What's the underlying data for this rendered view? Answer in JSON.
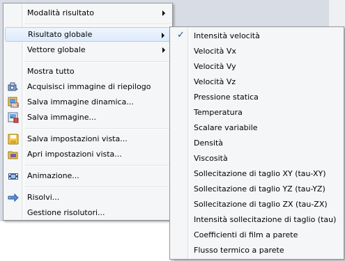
{
  "main_menu": {
    "items": [
      {
        "label": "Modalità risultato"
      },
      {
        "label": "Risultato globale"
      },
      {
        "label": "Vettore globale"
      },
      {
        "label": "Mostra tutto"
      },
      {
        "label": "Acquisisci immagine di riepilogo"
      },
      {
        "label": "Salva immagine dinamica..."
      },
      {
        "label": "Salva immagine..."
      },
      {
        "label": "Salva impostazioni vista..."
      },
      {
        "label": "Apri impostazioni vista..."
      },
      {
        "label": "Animazione..."
      },
      {
        "label": "Risolvi..."
      },
      {
        "label": "Gestione risolutori..."
      }
    ]
  },
  "sub_menu": {
    "checked_mark": "✓",
    "items": [
      {
        "label": "Intensità velocità"
      },
      {
        "label": "Velocità Vx"
      },
      {
        "label": "Velocità Vy"
      },
      {
        "label": "Velocità Vz"
      },
      {
        "label": "Pressione statica"
      },
      {
        "label": "Temperatura"
      },
      {
        "label": "Scalare variabile"
      },
      {
        "label": "Densità"
      },
      {
        "label": "Viscosità"
      },
      {
        "label": "Sollecitazione di taglio XY (tau-XY)"
      },
      {
        "label": "Sollecitazione di taglio YZ (tau-YZ)"
      },
      {
        "label": "Sollecitazione di taglio ZX (tau-ZX)"
      },
      {
        "label": "Intensità sollecitazione di taglio (tau)"
      },
      {
        "label": "Coefficienti di film a parete"
      },
      {
        "label": "Flusso termico a parete"
      }
    ]
  },
  "icons": {
    "acquire_summary": "camera-icon",
    "dynamic_image": "dynamic-image-icon",
    "save_image": "save-image-icon",
    "save_view": "save-view-icon",
    "open_view": "open-view-icon",
    "animation": "film-icon",
    "solve": "solve-icon"
  },
  "colors": {
    "menu_bg": "#f5f6f7",
    "highlight": "#dcebfc",
    "highlight_border": "#aecff7",
    "check": "#1d4f91"
  }
}
